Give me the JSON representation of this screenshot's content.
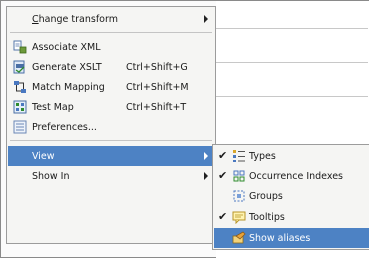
{
  "menu": {
    "change_transform": {
      "mnemonic": "C",
      "rest": "hange transform"
    },
    "associate_xml": "Associate XML",
    "generate_xslt": {
      "label": "Generate XSLT",
      "shortcut": "Ctrl+Shift+G"
    },
    "match_mapping": {
      "label": "Match Mapping",
      "shortcut": "Ctrl+Shift+M"
    },
    "test_map": {
      "label": "Test Map",
      "shortcut": "Ctrl+Shift+T"
    },
    "preferences": "Preferences...",
    "view": "View",
    "show_in": "Show In"
  },
  "submenu": {
    "types": {
      "label": "Types",
      "checked": true
    },
    "occurrence_indexes": {
      "label": "Occurrence Indexes",
      "checked": true
    },
    "groups": {
      "label": "Groups",
      "checked": false
    },
    "tooltips": {
      "label": "Tooltips",
      "checked": true
    },
    "show_aliases": {
      "label": "Show aliases",
      "checked": false
    }
  },
  "icons": {
    "checkmark": "✔"
  },
  "colors": {
    "selection": "#4d82c4",
    "menu_bg": "#f5f5f3"
  }
}
